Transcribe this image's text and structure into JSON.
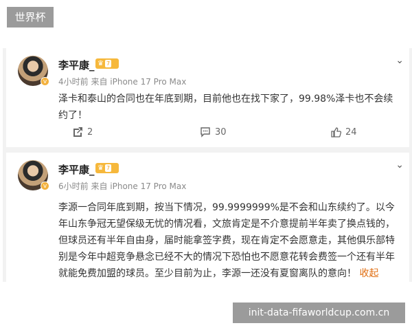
{
  "top_tag": "世界杯",
  "bottom_tag": "init-data-fifaworldcup.com.cn",
  "posts": [
    {
      "username": "李平康_",
      "level": "7",
      "meta": "4小时前 来自 iPhone 17 Pro Max",
      "text": "泽卡和泰山的合同也在年底到期，目前他也在找下家了，99.98%泽卡也不会续约了！",
      "reposts": "2",
      "comments": "30",
      "likes": "24"
    },
    {
      "username": "李平康_",
      "level": "7",
      "meta": "6小时前 来自 iPhone 17 Pro Max",
      "text": "李源一合同年底到期，按当下情况，99.9999999%是不会和山东续约了。以今年山东争冠无望保级无忧的情况看，文旅肯定是不介意提前半年卖了换点钱的，但球员还有半年自由身，届时能拿签字费，现在肯定不会愿意走，其他俱乐部特别是今年中超竞争悬念已经不大的情况下恐怕也不愿意花转会费签一个还有半年就能免费加盟的球员。至少目前为止，李源一还没有夏窗离队的意向！",
      "collapse_label": "收起"
    }
  ],
  "colors": {
    "accent": "#f6b83c",
    "collapse": "#e06d10"
  }
}
